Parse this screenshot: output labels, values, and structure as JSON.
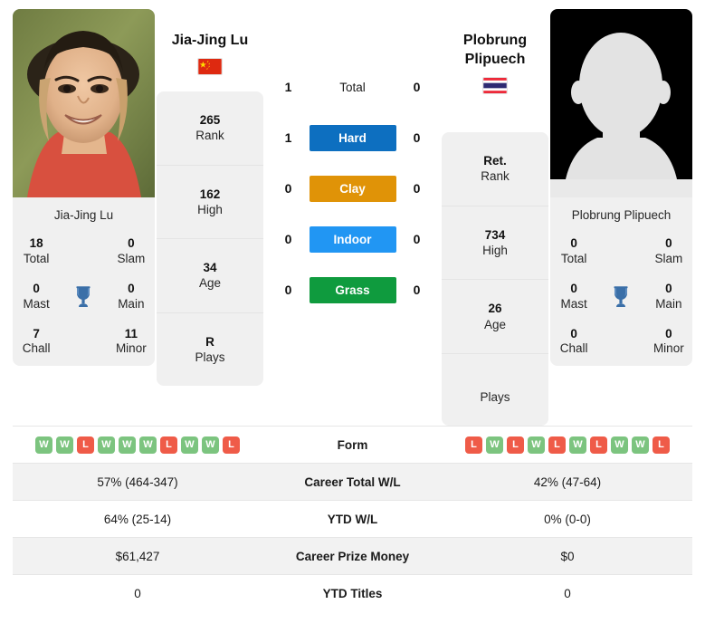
{
  "players": {
    "left": {
      "name": "Jia-Jing Lu",
      "photo_caption": "Jia-Jing Lu",
      "flag": "china-flag-icon",
      "flag_colors": {
        "field": "#de2910",
        "star": "#ffde00"
      },
      "avatar_type": "photo",
      "titles": [
        {
          "num": "18",
          "label": "Total"
        },
        {
          "num": "0",
          "label": "Slam"
        },
        {
          "num": "0",
          "label": "Mast"
        },
        {
          "num": "0",
          "label": "Main"
        },
        {
          "num": "7",
          "label": "Chall"
        },
        {
          "num": "11",
          "label": "Minor"
        }
      ],
      "rank_card": [
        {
          "num": "265",
          "label": "Rank"
        },
        {
          "num": "162",
          "label": "High"
        },
        {
          "num": "34",
          "label": "Age"
        },
        {
          "num": "R",
          "label": "Plays"
        }
      ]
    },
    "right": {
      "name": "Plobrung Plipuech",
      "name_line1": "Plobrung",
      "name_line2": "Plipuech",
      "photo_caption": "Plobrung Plipuech",
      "flag": "thailand-flag-icon",
      "flag_colors": {
        "red": "#ed2939",
        "white": "#ffffff",
        "blue": "#2d2a72"
      },
      "avatar_type": "silhouette-placeholder",
      "titles": [
        {
          "num": "0",
          "label": "Total"
        },
        {
          "num": "0",
          "label": "Slam"
        },
        {
          "num": "0",
          "label": "Mast"
        },
        {
          "num": "0",
          "label": "Main"
        },
        {
          "num": "0",
          "label": "Chall"
        },
        {
          "num": "0",
          "label": "Minor"
        }
      ],
      "rank_card": [
        {
          "num": "Ret.",
          "label": "Rank"
        },
        {
          "num": "734",
          "label": "High"
        },
        {
          "num": "26",
          "label": "Age"
        },
        {
          "num": "",
          "label": "Plays"
        }
      ]
    }
  },
  "head_to_head": {
    "rows": [
      {
        "left": "1",
        "label": "Total",
        "right": "0",
        "style": "plain",
        "color": ""
      },
      {
        "left": "1",
        "label": "Hard",
        "right": "0",
        "style": "badge",
        "color": "#0d6fc0"
      },
      {
        "left": "0",
        "label": "Clay",
        "right": "0",
        "style": "badge",
        "color": "#e09307"
      },
      {
        "left": "0",
        "label": "Indoor",
        "right": "0",
        "style": "badge",
        "color": "#2196f3"
      },
      {
        "left": "0",
        "label": "Grass",
        "right": "0",
        "style": "badge",
        "color": "#0f9b3e"
      }
    ]
  },
  "comparison_table": {
    "form": {
      "label": "Form",
      "left": [
        "W",
        "W",
        "L",
        "W",
        "W",
        "W",
        "L",
        "W",
        "W",
        "L"
      ],
      "right": [
        "L",
        "W",
        "L",
        "W",
        "L",
        "W",
        "L",
        "W",
        "W",
        "L"
      ]
    },
    "rows": [
      {
        "left": "57% (464-347)",
        "label": "Career Total W/L",
        "right": "42% (47-64)"
      },
      {
        "left": "64% (25-14)",
        "label": "YTD W/L",
        "right": "0% (0-0)"
      },
      {
        "left": "$61,427",
        "label": "Career Prize Money",
        "right": "$0"
      },
      {
        "left": "0",
        "label": "YTD Titles",
        "right": "0"
      }
    ]
  },
  "colors": {
    "win_badge": "#7cc47f",
    "loss_badge": "#ef5b48",
    "trophy": "#3a6fa8",
    "card_bg": "#f0f0f0",
    "row_shade": "#f2f2f2"
  }
}
